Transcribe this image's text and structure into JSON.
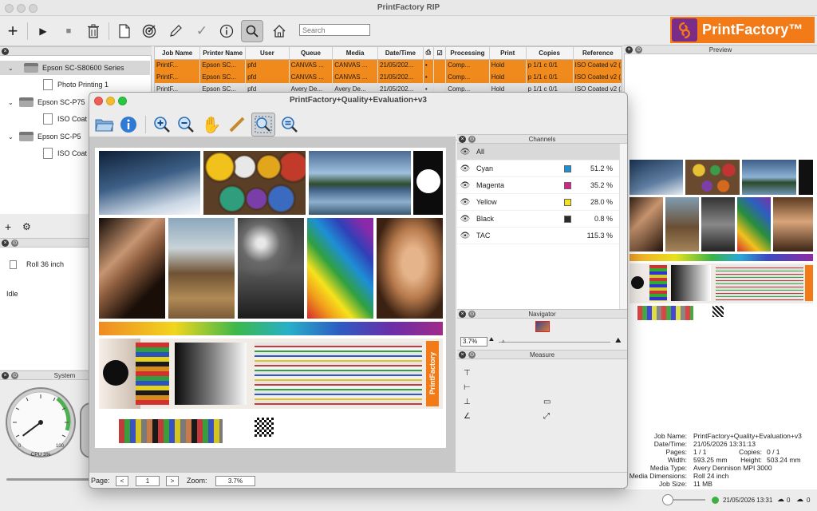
{
  "app": {
    "title": "PrintFactory RIP",
    "brand": "PrintFactory™"
  },
  "toolbar": {
    "search_placeholder": "Search"
  },
  "tree": {
    "items": [
      {
        "label": "Epson SC-S80600 Series"
      },
      {
        "label": "Photo Printing 1"
      },
      {
        "label": "Epson SC-P75"
      },
      {
        "label": "ISO Coat"
      },
      {
        "label": "Epson SC-P5"
      },
      {
        "label": "ISO Coat"
      }
    ]
  },
  "status": {
    "media": "Roll 36 inch",
    "state": "Idle"
  },
  "system": {
    "title": "System",
    "cpu_label": "CPU 3%",
    "cpu_value": 3,
    "ticks": [
      "0",
      "100"
    ]
  },
  "jobs": {
    "columns": [
      "Job Name",
      "Printer Name",
      "User",
      "Queue",
      "Media",
      "Date/Time",
      "",
      "",
      "Processing",
      "Print",
      "Copies",
      "Reference"
    ],
    "rows": [
      [
        "PrintF...",
        "Epson SC...",
        "pfd",
        "CANVAS ...",
        "CANVAS ...",
        "21/05/202...",
        "•",
        "",
        "Comp...",
        "Hold",
        "p 1/1 c 0/1",
        "ISO Coated v2 (..."
      ],
      [
        "PrintF...",
        "Epson SC...",
        "pfd",
        "CANVAS ...",
        "CANVAS ...",
        "21/05/202...",
        "•",
        "",
        "Comp...",
        "Hold",
        "p 1/1 c 0/1",
        "ISO Coated v2 (..."
      ],
      [
        "PrintF...",
        "Epson SC...",
        "pfd",
        "Avery De...",
        "Avery De...",
        "21/05/202...",
        "•",
        "",
        "Comp...",
        "Hold",
        "p 1/1 c 0/1",
        "ISO Coated v2 (..."
      ]
    ]
  },
  "preview": {
    "title": "Preview",
    "info": [
      {
        "label": "Job Name:",
        "value": "PrintFactory+Quality+Evaluation+v3"
      },
      {
        "label": "Date/Time:",
        "value": "21/05/2026 13:31:13"
      },
      {
        "label": "Pages:",
        "value": "1 / 1"
      },
      {
        "label": "Width:",
        "value": "593.25 mm"
      },
      {
        "label": "Media Type:",
        "value": "Avery Dennison MPI 3000"
      },
      {
        "label": "Media Dimensions:",
        "value": "Roll 24 inch"
      },
      {
        "label": "Job Size:",
        "value": "11 MB"
      }
    ],
    "copies_label": "Copies:",
    "copies_value": "0 / 1",
    "height_label": "Height:",
    "height_value": "503.24 mm"
  },
  "viewer": {
    "title": "PrintFactory+Quality+Evaluation+v3",
    "page_label": "Page:",
    "page_value": "1",
    "zoom_label": "Zoom:",
    "zoom_value": "3.7%",
    "brand_vertical": "PrintFactory"
  },
  "channels": {
    "title": "Channels",
    "items": [
      {
        "name": "All",
        "pct": "",
        "color": ""
      },
      {
        "name": "Cyan",
        "pct": "51.2 %",
        "color": "#1a8fd4"
      },
      {
        "name": "Magenta",
        "pct": "35.2 %",
        "color": "#d0248a"
      },
      {
        "name": "Yellow",
        "pct": "28.0 %",
        "color": "#f3e21a"
      },
      {
        "name": "Black",
        "pct": "0.8 %",
        "color": "#2a2a2a"
      },
      {
        "name": "TAC",
        "pct": "115.3 %",
        "color": ""
      }
    ]
  },
  "navigator": {
    "title": "Navigator",
    "zoom": "3.7%"
  },
  "measure": {
    "title": "Measure"
  },
  "footer": {
    "datetime": "21/05/2026 13:31",
    "count1": "0",
    "count2": "0"
  }
}
